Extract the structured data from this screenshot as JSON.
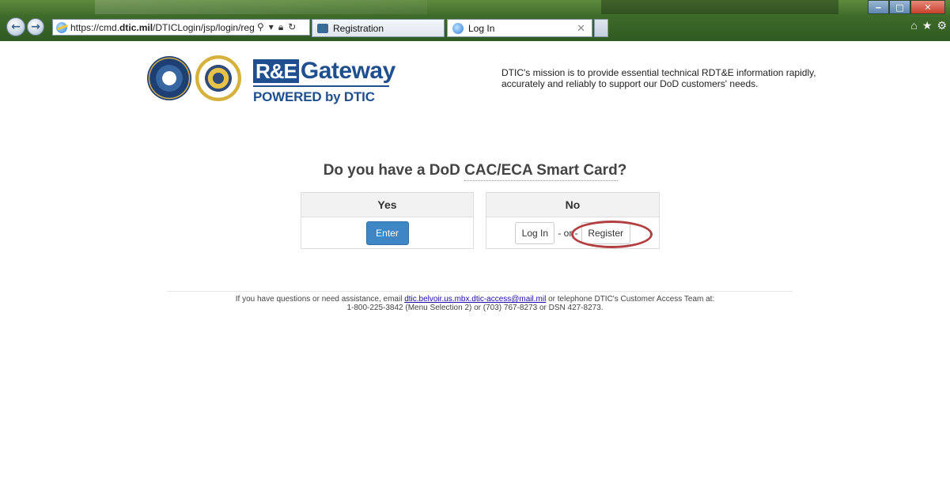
{
  "browser": {
    "url": "https://cmd.dtic.mil/DTICLogin/jsp/login/reg-logi",
    "url_host_plain": "https://cmd.",
    "url_host_bold": "dtic.mil",
    "url_path": "/DTICLogin/jsp/login/reg-logi",
    "tabs": [
      {
        "label": "Registration",
        "active": false
      },
      {
        "label": "Log In",
        "active": true
      }
    ],
    "address_tools": [
      "search-icon",
      "dropdown-icon",
      "lock-icon",
      "refresh-icon"
    ],
    "right_icons": [
      "home-icon",
      "star-icon",
      "gear-icon"
    ]
  },
  "header": {
    "logo_main_re": "R&E",
    "logo_main_gateway": "Gateway",
    "logo_sub": "POWERED by DTIC",
    "mission": "DTIC's mission is to provide essential technical RDT&E information rapidly, accurately and reliably to support our DoD customers' needs."
  },
  "main": {
    "question_prefix": "Do you have a DoD ",
    "question_underlined": "CAC/ECA Smart Card",
    "question_suffix": "?",
    "yes_panel": {
      "title": "Yes",
      "button": "Enter"
    },
    "no_panel": {
      "title": "No",
      "login_button": "Log In",
      "or_text": "- or -",
      "register_button": "Register"
    }
  },
  "footer": {
    "line1_before": "If you have questions or need assistance, email ",
    "email": "dtic.belvoir.us.mbx.dtic-access@mail.mil",
    "line1_after": " or telephone DTIC's Customer Access Team at:",
    "line2": "1-800-225-3842 (Menu Selection 2) or (703) 767-8273 or DSN 427-8273."
  },
  "colors": {
    "brand_blue": "#1f4f8e",
    "enter_button": "#3f86c6",
    "highlight_ring": "#b34040"
  }
}
